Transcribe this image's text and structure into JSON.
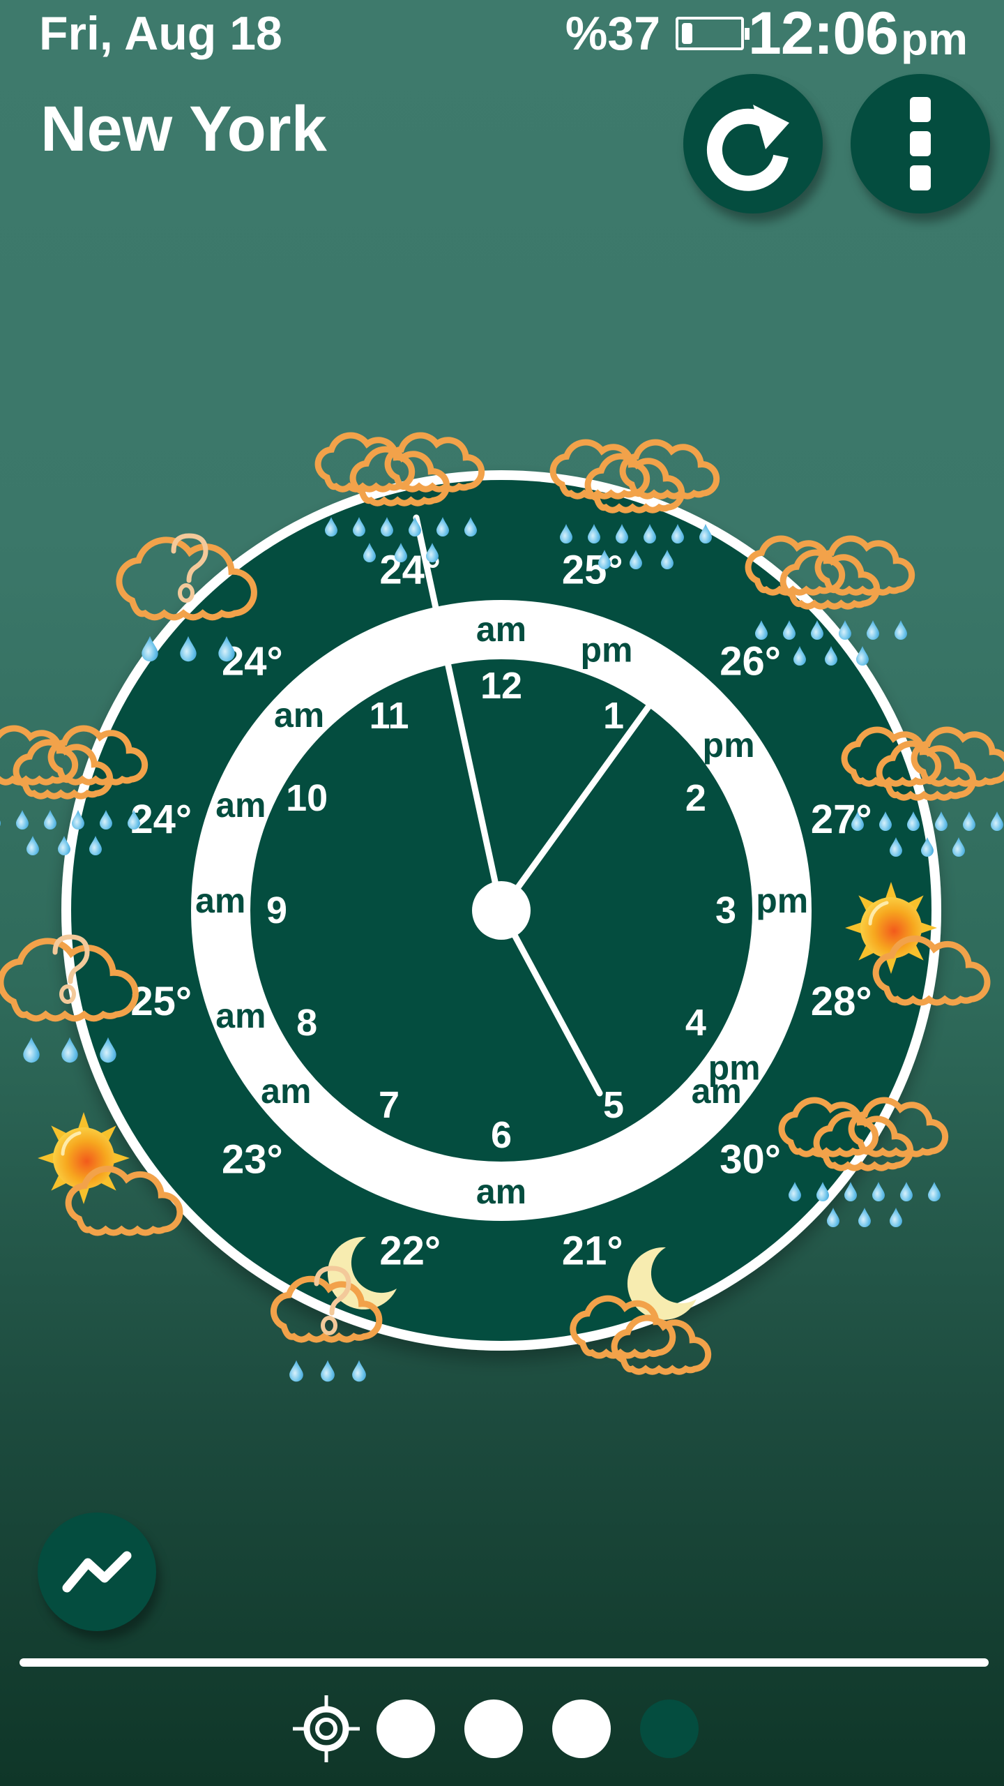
{
  "status_bar": {
    "date": "Fri, Aug 18",
    "battery_percent_label": "%37",
    "battery_level": 0.37,
    "time": "12:06",
    "ampm": "pm"
  },
  "header": {
    "city": "New York",
    "refresh_icon": "refresh-icon",
    "menu_icon": "more-vertical-icon"
  },
  "clock": {
    "current_time": "12:06 pm",
    "hour_numbers": [
      "12",
      "1",
      "2",
      "3",
      "4",
      "5",
      "6",
      "7",
      "8",
      "9",
      "10",
      "11"
    ],
    "ring_labels": [
      {
        "hour": "12",
        "label": "am"
      },
      {
        "hour": "1",
        "label": "pm"
      },
      {
        "hour": "2",
        "label": "pm"
      },
      {
        "hour": "3",
        "label": "pm"
      },
      {
        "hour": "4",
        "label": "pm"
      },
      {
        "hour": "5",
        "label": "am"
      },
      {
        "hour": "6",
        "label": "am"
      },
      {
        "hour": "7",
        "label": "am"
      },
      {
        "hour": "8",
        "label": "am"
      },
      {
        "hour": "9",
        "label": "am"
      },
      {
        "hour": "10",
        "label": "am"
      },
      {
        "hour": "11",
        "label": "am"
      }
    ],
    "forecast": [
      {
        "slot": "12-1",
        "temp": "25°",
        "condition": "heavy-rain"
      },
      {
        "slot": "1-2",
        "temp": "26°",
        "condition": "heavy-rain"
      },
      {
        "slot": "2-3",
        "temp": "27°",
        "condition": "heavy-rain"
      },
      {
        "slot": "3-4",
        "temp": "28°",
        "condition": "partly-cloudy-day"
      },
      {
        "slot": "4-5",
        "temp": "30°",
        "condition": "heavy-rain"
      },
      {
        "slot": "5-6",
        "temp": "21°",
        "condition": "partly-cloudy-night"
      },
      {
        "slot": "6-7",
        "temp": "22°",
        "condition": "unknown-rain-night"
      },
      {
        "slot": "7-8",
        "temp": "23°",
        "condition": "partly-cloudy-day"
      },
      {
        "slot": "8-9",
        "temp": "25°",
        "condition": "unknown-rain"
      },
      {
        "slot": "9-10",
        "temp": "24°",
        "condition": "heavy-rain"
      },
      {
        "slot": "10-11",
        "temp": "24°",
        "condition": "unknown-rain"
      },
      {
        "slot": "11-12",
        "temp": "24°",
        "condition": "heavy-rain"
      }
    ]
  },
  "footer": {
    "chart_icon": "trend-chart-icon",
    "pager": {
      "location_icon": "my-location-icon",
      "page_count": 4,
      "current_page": 4
    }
  },
  "colors": {
    "dark_green": "#044d3f",
    "cloud_orange": "#f2a24a",
    "rain_blue": "#5bb8e6",
    "sun_yellow": "#f7c12c",
    "moon_cream": "#f7ecb0"
  }
}
